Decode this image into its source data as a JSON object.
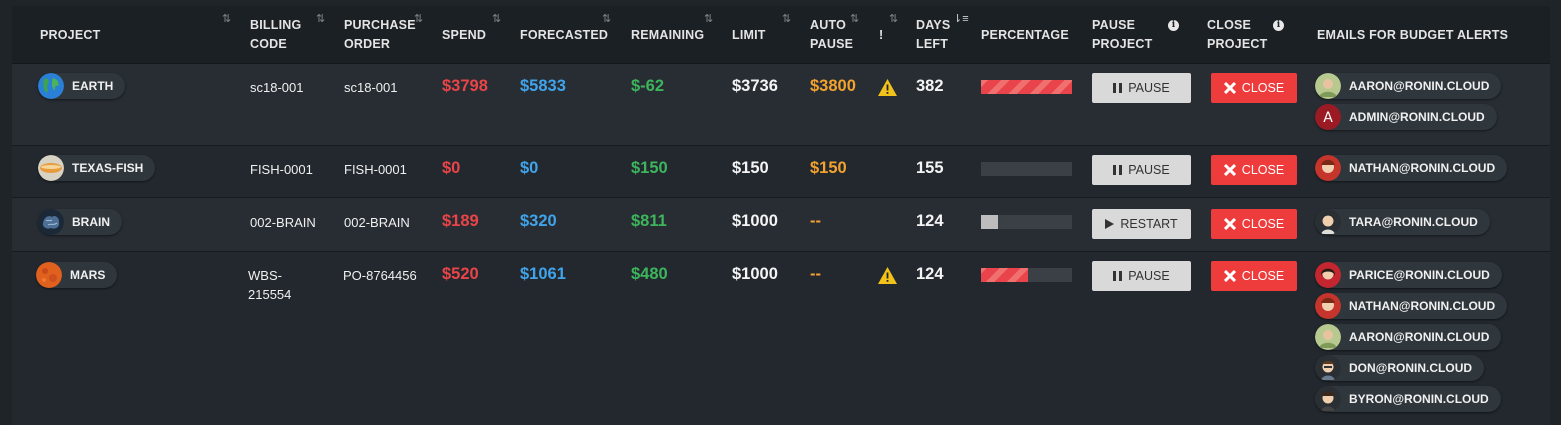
{
  "headers": {
    "project": "PROJECT",
    "billing_code": [
      "BILLING",
      "CODE"
    ],
    "purchase_order": [
      "PURCHASE",
      "ORDER"
    ],
    "spend": "SPEND",
    "forecasted": "FORECASTED",
    "remaining": "REMAINING",
    "limit": "LIMIT",
    "auto_pause": [
      "AUTO",
      "PAUSE"
    ],
    "alert": "!",
    "days_left": [
      "DAYS",
      "LEFT"
    ],
    "percentage": "PERCENTAGE",
    "pause_project": [
      "PAUSE",
      "PROJECT"
    ],
    "close_project": [
      "CLOSE",
      "PROJECT"
    ],
    "emails": "EMAILS FOR BUDGET ALERTS"
  },
  "icons": {
    "sort": "sort-arrows-icon",
    "sort_desc": "sort-descending-icon",
    "info": "info-icon",
    "warning": "warning-triangle-icon",
    "pause": "pause-icon",
    "play": "play-icon",
    "close": "x-icon"
  },
  "colors": {
    "spend": "#e94448",
    "forecasted": "#41a4ea",
    "remaining": "#3db55c",
    "auto_pause": "#f3a32d",
    "close_button": "#ee3b3b",
    "warning": "#f2c21a"
  },
  "rows": [
    {
      "project": "EARTH",
      "billing_code": "sc18-001",
      "purchase_order": "sc18-001",
      "spend": "$3798",
      "forecasted": "$5833",
      "remaining": "$-62",
      "limit": "$3736",
      "auto_pause": "$3800",
      "warning": true,
      "days_left": "382",
      "percentage": 1.0,
      "pause_label": "PAUSE",
      "close_label": "CLOSE",
      "emails": [
        "AARON@RONIN.CLOUD",
        "ADMIN@RONIN.CLOUD"
      ]
    },
    {
      "project": "TEXAS-FISH",
      "billing_code": "FISH-0001",
      "purchase_order": "FISH-0001",
      "spend": "$0",
      "forecasted": "$0",
      "remaining": "$150",
      "limit": "$150",
      "auto_pause": "$150",
      "warning": false,
      "days_left": "155",
      "percentage": 0.0,
      "pause_label": "PAUSE",
      "close_label": "CLOSE",
      "emails": [
        "NATHAN@RONIN.CLOUD"
      ]
    },
    {
      "project": "BRAIN",
      "billing_code": "002-BRAIN",
      "purchase_order": "002-BRAIN",
      "spend": "$189",
      "forecasted": "$320",
      "remaining": "$811",
      "limit": "$1000",
      "auto_pause": "--",
      "warning": false,
      "days_left": "124",
      "percentage": 0.19,
      "pause_label": "RESTART",
      "close_label": "CLOSE",
      "emails": [
        "TARA@RONIN.CLOUD"
      ]
    },
    {
      "project": "MARS",
      "billing_code": "WBS-215554",
      "purchase_order": "PO-8764456",
      "spend": "$520",
      "forecasted": "$1061",
      "remaining": "$480",
      "limit": "$1000",
      "auto_pause": "--",
      "warning": true,
      "days_left": "124",
      "percentage": 0.52,
      "pause_label": "PAUSE",
      "close_label": "CLOSE",
      "emails": [
        "PARICE@RONIN.CLOUD",
        "NATHAN@RONIN.CLOUD",
        "AARON@RONIN.CLOUD",
        "DON@RONIN.CLOUD",
        "BYRON@RONIN.CLOUD"
      ]
    }
  ]
}
